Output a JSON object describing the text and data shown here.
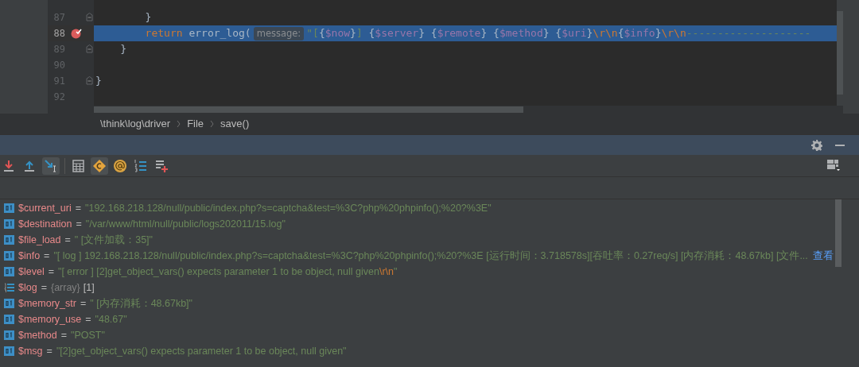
{
  "editor": {
    "lines": [
      {
        "number": "87",
        "current": false,
        "breakpoint": false,
        "fold": true,
        "tokens": [
          {
            "kind": "plain",
            "text": "        }"
          }
        ]
      },
      {
        "number": "88",
        "current": true,
        "breakpoint": true,
        "fold": false,
        "tokens": [
          {
            "kind": "keyword",
            "text": "        return "
          },
          {
            "kind": "plain",
            "text": "error_log("
          },
          {
            "kind": "hint",
            "text": "message:"
          },
          {
            "kind": "string",
            "text": "\"["
          },
          {
            "kind": "plain",
            "text": "{"
          },
          {
            "kind": "variable",
            "text": "$now"
          },
          {
            "kind": "plain",
            "text": "}"
          },
          {
            "kind": "string",
            "text": "]"
          },
          {
            "kind": "plain",
            "text": " {"
          },
          {
            "kind": "variable",
            "text": "$server"
          },
          {
            "kind": "plain",
            "text": "}"
          },
          {
            "kind": "plain",
            "text": " {"
          },
          {
            "kind": "variable",
            "text": "$remote"
          },
          {
            "kind": "plain",
            "text": "}"
          },
          {
            "kind": "plain",
            "text": " {"
          },
          {
            "kind": "variable",
            "text": "$method"
          },
          {
            "kind": "plain",
            "text": "}"
          },
          {
            "kind": "plain",
            "text": " {"
          },
          {
            "kind": "variable",
            "text": "$uri"
          },
          {
            "kind": "plain",
            "text": "}"
          },
          {
            "kind": "escape",
            "text": "\\r\\n"
          },
          {
            "kind": "plain",
            "text": "{"
          },
          {
            "kind": "variable",
            "text": "$info"
          },
          {
            "kind": "plain",
            "text": "}"
          },
          {
            "kind": "escape",
            "text": "\\r\\n"
          },
          {
            "kind": "string",
            "text": "--------------------"
          }
        ]
      },
      {
        "number": "89",
        "current": false,
        "breakpoint": false,
        "fold": true,
        "tokens": [
          {
            "kind": "plain",
            "text": "    }"
          }
        ]
      },
      {
        "number": "90",
        "current": false,
        "breakpoint": false,
        "fold": false
      },
      {
        "number": "91",
        "current": false,
        "breakpoint": false,
        "fold": true,
        "tokens": [
          {
            "kind": "plain",
            "text": "}"
          }
        ]
      },
      {
        "number": "92",
        "current": false,
        "breakpoint": false,
        "fold": false
      }
    ]
  },
  "breadcrumbs": [
    "\\think\\log\\driver",
    "File",
    "save()"
  ],
  "toolbar": [
    {
      "selected": false
    },
    {
      "selected": false
    },
    {
      "selected": true
    },
    {
      "selected": false
    },
    {
      "selected": true
    },
    {
      "selected": false
    },
    {
      "selected": false
    },
    {
      "selected": false
    }
  ],
  "variables": [
    {
      "kind": "primitive",
      "name": "$current_uri",
      "equals": "=",
      "value": [
        {
          "kind": "string",
          "text": "\"192.168.218.128/null/public/index.php?s=captcha&test=%3C?php%20phpinfo();%20?%3E\""
        }
      ]
    },
    {
      "kind": "primitive",
      "name": "$destination",
      "equals": "=",
      "value": [
        {
          "kind": "string",
          "text": "\"/var/www/html/null/public/logs202011/15.log\""
        }
      ]
    },
    {
      "kind": "primitive",
      "name": "$file_load",
      "equals": "=",
      "value": [
        {
          "kind": "string",
          "text": "\" [文件加载：35]\""
        }
      ]
    },
    {
      "kind": "primitive",
      "name": "$info",
      "equals": "=",
      "value": [
        {
          "kind": "string",
          "text": "\"[ log ] 192.168.218.128/null/public/index.php?s=captcha&test=%3C?php%20phpinfo();%20?%3E [运行时间：3.718578s][吞吐率：0.27req/s] [内存消耗：48.67kb] [文件..."
        },
        {
          "kind": "link",
          "text": "查看"
        }
      ]
    },
    {
      "kind": "primitive",
      "name": "$level",
      "equals": "=",
      "value": [
        {
          "kind": "string",
          "text": "\"[ error ] [2]get_object_vars() expects parameter 1 to be object, null given"
        },
        {
          "kind": "escape",
          "text": "\\r\\n"
        },
        {
          "kind": "string",
          "text": "\""
        }
      ]
    },
    {
      "kind": "array",
      "name": "$log",
      "equals": "=",
      "value": [
        {
          "kind": "type",
          "text": "{array}"
        },
        {
          "kind": "plain",
          "text": "[1]"
        }
      ]
    },
    {
      "kind": "primitive",
      "name": "$memory_str",
      "equals": "=",
      "value": [
        {
          "kind": "string",
          "text": "\" [内存消耗：48.67kb]\""
        }
      ]
    },
    {
      "kind": "primitive",
      "name": "$memory_use",
      "equals": "=",
      "value": [
        {
          "kind": "string",
          "text": "\"48.67\""
        }
      ]
    },
    {
      "kind": "primitive",
      "name": "$method",
      "equals": "=",
      "value": [
        {
          "kind": "string",
          "text": "\"POST\""
        }
      ]
    },
    {
      "kind": "primitive",
      "name": "$msg",
      "equals": "=",
      "value": [
        {
          "kind": "string",
          "text": "\"[2]get_object_vars() expects parameter 1 to be object, null given\""
        }
      ]
    }
  ]
}
